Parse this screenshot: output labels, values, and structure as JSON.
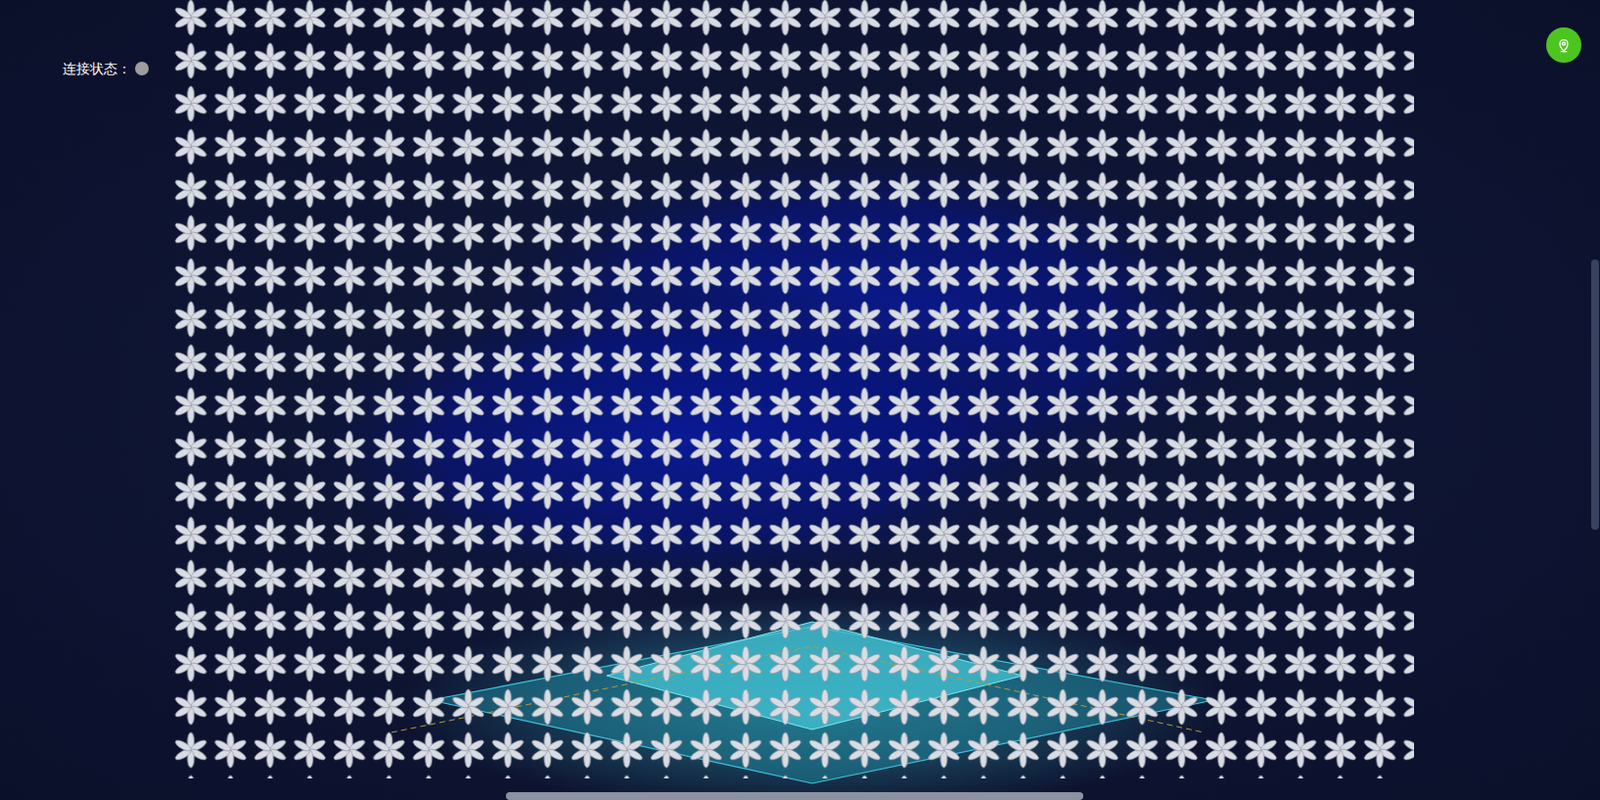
{
  "status": {
    "label": "连接状态：",
    "connected": false
  }
}
